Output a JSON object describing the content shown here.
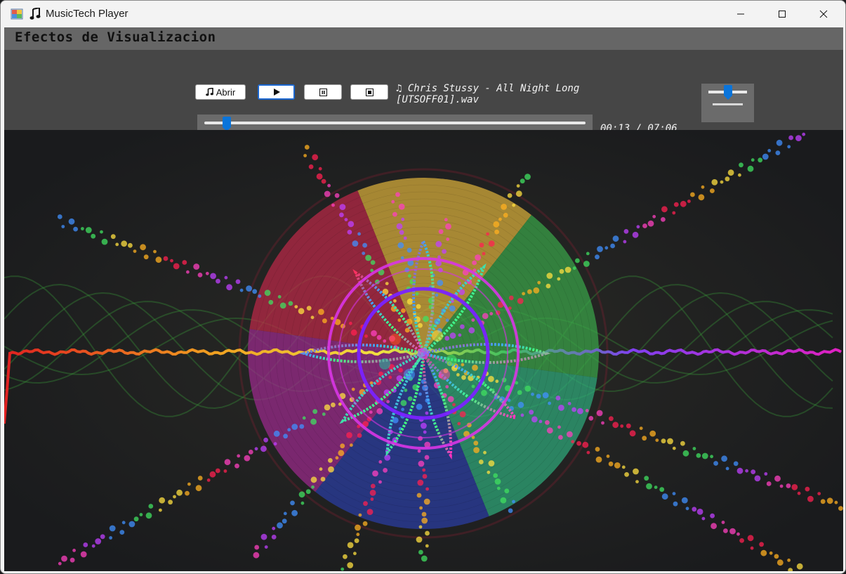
{
  "window": {
    "title": "MusicTech Player",
    "icons": {
      "app": "app-icon",
      "note": "music-note-icon"
    },
    "buttons": {
      "minimize": "minimize-icon",
      "maximize": "maximize-icon",
      "close": "close-icon"
    }
  },
  "header": {
    "title": "Efectos de Visualizacion"
  },
  "controls": {
    "open_label": "Abrir",
    "open_icon": "music-note-icon",
    "play_icon": "play-icon",
    "pause_icon": "pause-icon",
    "stop_icon": "stop-icon",
    "track_line1": "♫ Chris Stussy - All Night Long",
    "track_line2": "[UTSOFF01].wav",
    "time": "00:13 / 07:06",
    "seek_progress": 0.03,
    "volume_level": 0.5
  },
  "visualization": {
    "description_icon": "audio-visualizer",
    "wheel_colors": [
      "#e0b43c",
      "#3aa84a",
      "#2fae7e",
      "#2b3fa8",
      "#a02a90",
      "#c02848"
    ],
    "ring_colors": [
      "#d935e6",
      "#7a22ff"
    ]
  }
}
